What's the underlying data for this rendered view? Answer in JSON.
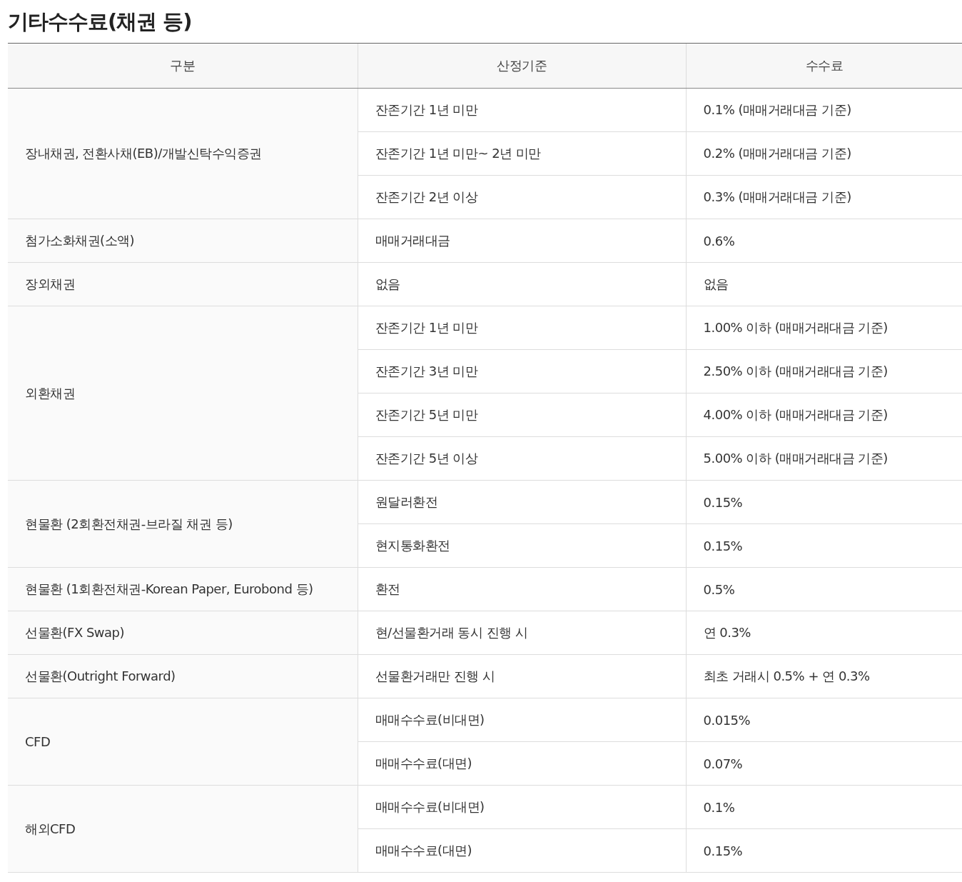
{
  "title": "기타수수료(채권 등)",
  "table": {
    "columns": [
      "구분",
      "산정기준",
      "수수료"
    ],
    "groups": [
      {
        "category": "장내채권, 전환사채(EB)/개발신탁수익증권",
        "rows": [
          {
            "basis": "잔존기간 1년 미만",
            "fee": "0.1% (매매거래대금 기준)"
          },
          {
            "basis": "잔존기간 1년 미만~ 2년 미만",
            "fee": "0.2% (매매거래대금 기준)"
          },
          {
            "basis": "잔존기간 2년 이상",
            "fee": "0.3% (매매거래대금 기준)"
          }
        ]
      },
      {
        "category": "첨가소화채권(소액)",
        "rows": [
          {
            "basis": "매매거래대금",
            "fee": "0.6%"
          }
        ]
      },
      {
        "category": "장외채권",
        "rows": [
          {
            "basis": "없음",
            "fee": "없음"
          }
        ]
      },
      {
        "category": "외환채권",
        "rows": [
          {
            "basis": "잔존기간 1년 미만",
            "fee": "1.00% 이하 (매매거래대금 기준)"
          },
          {
            "basis": "잔존기간 3년 미만",
            "fee": "2.50% 이하 (매매거래대금 기준)"
          },
          {
            "basis": "잔존기간 5년 미만",
            "fee": "4.00% 이하 (매매거래대금 기준)"
          },
          {
            "basis": "잔존기간 5년 이상",
            "fee": "5.00% 이하 (매매거래대금 기준)"
          }
        ]
      },
      {
        "category": "현물환 (2회환전채권-브라질 채권 등)",
        "rows": [
          {
            "basis": "원달러환전",
            "fee": "0.15%"
          },
          {
            "basis": "현지통화환전",
            "fee": "0.15%"
          }
        ]
      },
      {
        "category": "현물환 (1회환전채권-Korean Paper, Eurobond 등)",
        "rows": [
          {
            "basis": "환전",
            "fee": "0.5%"
          }
        ]
      },
      {
        "category": "선물환(FX Swap)",
        "rows": [
          {
            "basis": "현/선물환거래 동시 진행 시",
            "fee": "연 0.3%"
          }
        ]
      },
      {
        "category": "선물환(Outright Forward)",
        "rows": [
          {
            "basis": "선물환거래만 진행 시",
            "fee": "최초 거래시 0.5% + 연 0.3%"
          }
        ]
      },
      {
        "category": "CFD",
        "rows": [
          {
            "basis": "매매수수료(비대면)",
            "fee": "0.015%"
          },
          {
            "basis": "매매수수료(대면)",
            "fee": "0.07%"
          }
        ]
      },
      {
        "category": "해외CFD",
        "rows": [
          {
            "basis": "매매수수료(비대면)",
            "fee": "0.1%"
          },
          {
            "basis": "매매수수료(대면)",
            "fee": "0.15%"
          }
        ]
      }
    ]
  }
}
